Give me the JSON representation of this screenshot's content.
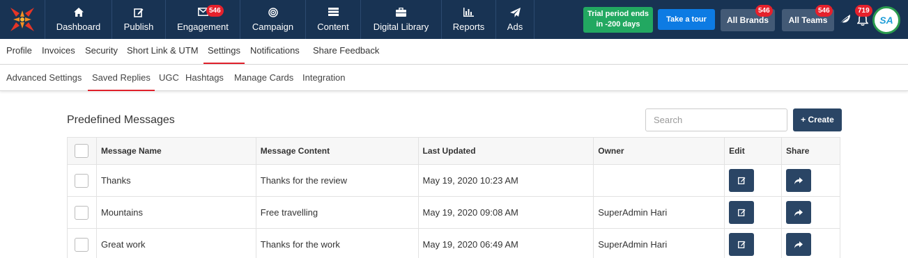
{
  "colors": {
    "topbar": "#183353",
    "accent_red": "#e0202b",
    "trial_green": "#22a861",
    "tour_blue": "#0d7be3",
    "dark_button": "#2a4565"
  },
  "nav": {
    "items": [
      {
        "label": "Dashboard",
        "icon": "home-icon"
      },
      {
        "label": "Publish",
        "icon": "edit-icon"
      },
      {
        "label": "Engagement",
        "icon": "mail-icon",
        "badge": "546"
      },
      {
        "label": "Campaign",
        "icon": "target-icon"
      },
      {
        "label": "Content",
        "icon": "list-icon"
      },
      {
        "label": "Digital Library",
        "icon": "briefcase-icon"
      },
      {
        "label": "Reports",
        "icon": "bar-chart-icon"
      },
      {
        "label": "Ads",
        "icon": "paper-plane-icon"
      }
    ],
    "trial_line1": "Trial period ends",
    "trial_line2": "in -200 days",
    "tour": "Take a tour",
    "brands": "All Brands",
    "brands_badge": "546",
    "teams": "All Teams",
    "teams_badge": "546",
    "notif_badge": "719",
    "avatar_initials": "SA"
  },
  "tabs1": [
    "Profile",
    "Invoices",
    "Security",
    "Short Link & UTM",
    "Settings",
    "Notifications",
    "Share Feedback"
  ],
  "tabs2": [
    "Advanced Settings",
    "Saved Replies",
    "UGC",
    "Hashtags",
    "Manage Cards",
    "Integration"
  ],
  "page": {
    "title": "Predefined Messages",
    "search_placeholder": "Search",
    "create": "+ Create"
  },
  "table": {
    "headers": [
      "Message Name",
      "Message Content",
      "Last Updated",
      "Owner",
      "Edit",
      "Share"
    ],
    "rows": [
      {
        "name": "Thanks",
        "content": "Thanks for the review",
        "updated": "May 19, 2020 10:23 AM",
        "owner": ""
      },
      {
        "name": "Mountains",
        "content": "Free travelling",
        "updated": "May 19, 2020 09:08 AM",
        "owner": "SuperAdmin Hari"
      },
      {
        "name": "Great work",
        "content": "Thanks for the work",
        "updated": "May 19, 2020 06:49 AM",
        "owner": "SuperAdmin Hari"
      }
    ]
  }
}
